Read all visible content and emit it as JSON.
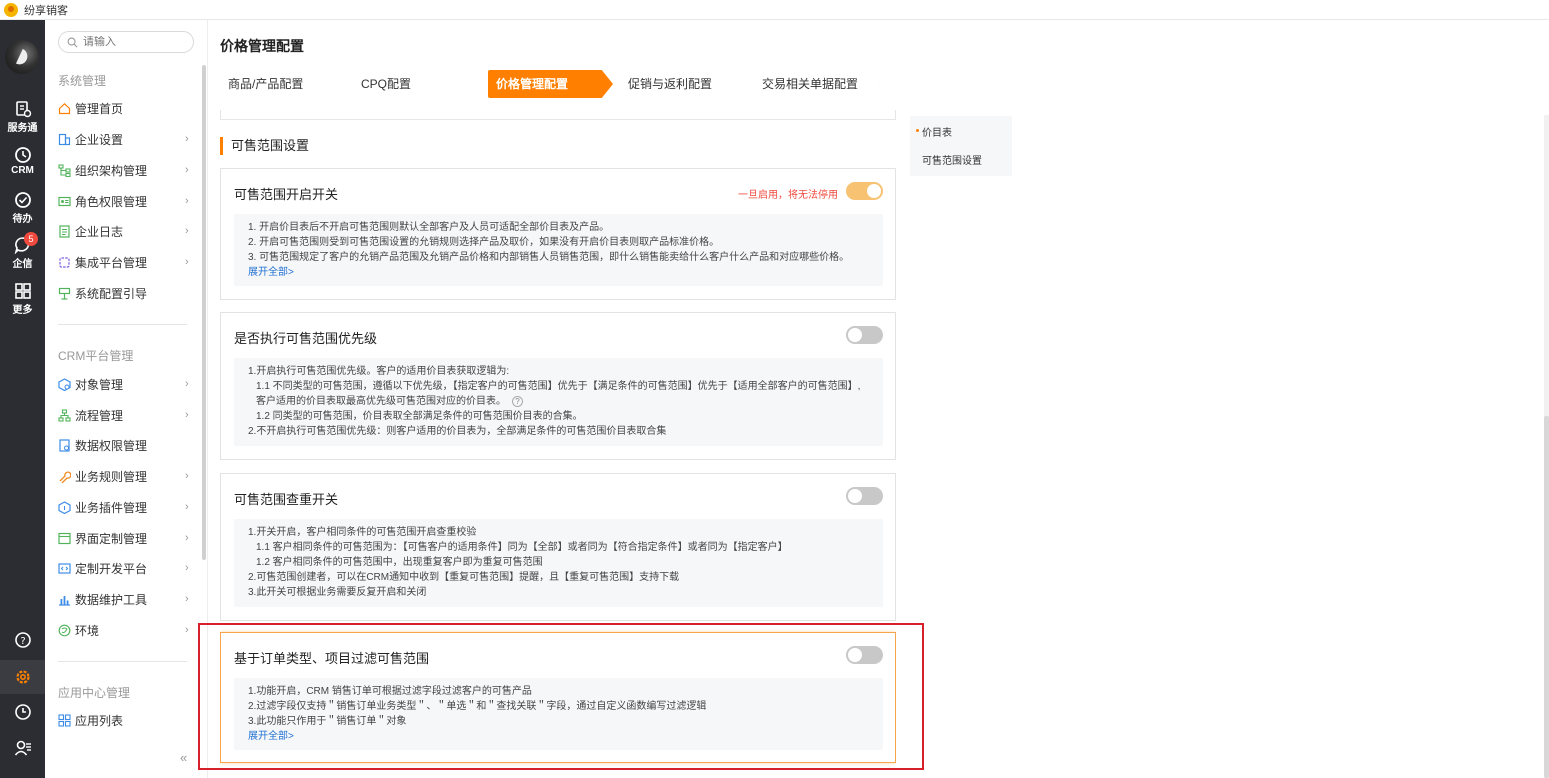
{
  "app": {
    "title": "纷享销客"
  },
  "rail": {
    "items": [
      {
        "label": "服务通",
        "icon": "service-icon"
      },
      {
        "label": "CRM",
        "icon": "crm-clock-icon"
      },
      {
        "label": "待办",
        "icon": "todo-check-icon"
      },
      {
        "label": "企信",
        "icon": "chat-bubble-icon",
        "badge": "5"
      },
      {
        "label": "更多",
        "icon": "grid-more-icon"
      }
    ],
    "bottom_icons": [
      "help-icon",
      "settings-gear-icon",
      "history-clock-icon",
      "user-admin-icon"
    ]
  },
  "sidebar": {
    "search_placeholder": "请输入",
    "group_system": "系统管理",
    "system_items": [
      {
        "label": "管理首页",
        "icon": "home-icon",
        "chevron": false
      },
      {
        "label": "企业设置",
        "icon": "enterprise-icon",
        "chevron": true
      },
      {
        "label": "组织架构管理",
        "icon": "org-tree-icon",
        "chevron": true
      },
      {
        "label": "角色权限管理",
        "icon": "role-card-icon",
        "chevron": true
      },
      {
        "label": "企业日志",
        "icon": "log-icon",
        "chevron": true
      },
      {
        "label": "集成平台管理",
        "icon": "integration-icon",
        "chevron": true
      },
      {
        "label": "系统配置引导",
        "icon": "guide-icon",
        "chevron": false
      }
    ],
    "group_crm": "CRM平台管理",
    "crm_items": [
      {
        "label": "对象管理",
        "icon": "object-icon",
        "chevron": true
      },
      {
        "label": "流程管理",
        "icon": "flow-icon",
        "chevron": true
      },
      {
        "label": "数据权限管理",
        "icon": "data-permission-icon",
        "chevron": false
      },
      {
        "label": "业务规则管理",
        "icon": "rule-wrench-icon",
        "chevron": true
      },
      {
        "label": "业务插件管理",
        "icon": "plugin-icon",
        "chevron": true
      },
      {
        "label": "界面定制管理",
        "icon": "ui-layout-icon",
        "chevron": true
      },
      {
        "label": "定制开发平台",
        "icon": "code-icon",
        "chevron": true
      },
      {
        "label": "数据维护工具",
        "icon": "bar-chart-icon",
        "chevron": true
      },
      {
        "label": "环境",
        "icon": "environment-icon",
        "chevron": true
      }
    ],
    "group_app": "应用中心管理",
    "app_items": [
      {
        "label": "应用列表",
        "icon": "app-grid-icon",
        "chevron": false
      }
    ],
    "collapse_symbol": "«"
  },
  "main": {
    "page_title": "价格管理配置",
    "tabs": [
      {
        "label": "商品/产品配置",
        "active": false
      },
      {
        "label": "CPQ配置",
        "active": false
      },
      {
        "label": "价格管理配置",
        "active": true
      },
      {
        "label": "促销与返利配置",
        "active": false
      },
      {
        "label": "交易相关单据配置",
        "active": false
      }
    ],
    "section_title": "可售范围设置",
    "cards": [
      {
        "title": "可售范围开启开关",
        "warning": "一旦启用，将无法停用",
        "toggle_on": true,
        "lines": [
          "1. 开启价目表后不开启可售范围则默认全部客户及人员可适配全部价目表及产品。",
          "2. 开启可售范围则受到可售范围设置的允销规则选择产品及取价，如果没有开启价目表则取产品标准价格。",
          "3. 可售范围规定了客户的允销产品范围及允销产品价格和内部销售人员销售范围，即什么销售能卖给什么客户什么产品和对应哪些价格。"
        ],
        "expand": "展开全部>"
      },
      {
        "title": "是否执行可售范围优先级",
        "toggle_on": false,
        "lines": [
          "1.开启执行可售范围优先级。客户的适用价目表获取逻辑为:",
          "1.1 不同类型的可售范围，遵循以下优先级，【指定客户的可售范围】优先于【满足条件的可售范围】优先于【适用全部客户的可售范围】,",
          "客户适用的价目表取最高优先级可售范围对应的价目表。",
          "1.2 同类型的可售范围，价目表取全部满足条件的可售范围价目表的合集。",
          "2.不开启执行可售范围优先级：则客户适用的价目表为，全部满足条件的可售范围价目表取合集"
        ]
      },
      {
        "title": "可售范围查重开关",
        "toggle_on": false,
        "lines": [
          "1.开关开启，客户相同条件的可售范围开启查重校验",
          "1.1 客户相同条件的可售范围为：【可售客户的适用条件】同为【全部】或者同为【符合指定条件】或者同为【指定客户】",
          "1.2 客户相同条件的可售范围中，出现重复客户即为重复可售范围",
          "2.可售范围创建者，可以在CRM通知中收到【重复可售范围】提醒，且【重复可售范围】支持下载",
          "3.此开关可根据业务需要反复开启和关闭"
        ]
      },
      {
        "title": "基于订单类型、项目过滤可售范围",
        "toggle_on": false,
        "lines": [
          "1.功能开启，CRM 销售订单可根据过滤字段过滤客户的可售产品",
          "2.过滤字段仅支持＂销售订单业务类型＂、＂单选＂和＂查找关联＂字段，通过自定义函数编写过滤逻辑",
          "3.此功能只作用于＂销售订单＂对象"
        ],
        "expand": "展开全部>"
      }
    ]
  },
  "anchors": [
    {
      "label": "价目表"
    },
    {
      "label": "可售范围设置"
    }
  ],
  "colors": {
    "accent": "#ff8000",
    "rail": "#2b2d33",
    "highlight_box": "#d8202a",
    "link": "#1f6fd1"
  }
}
